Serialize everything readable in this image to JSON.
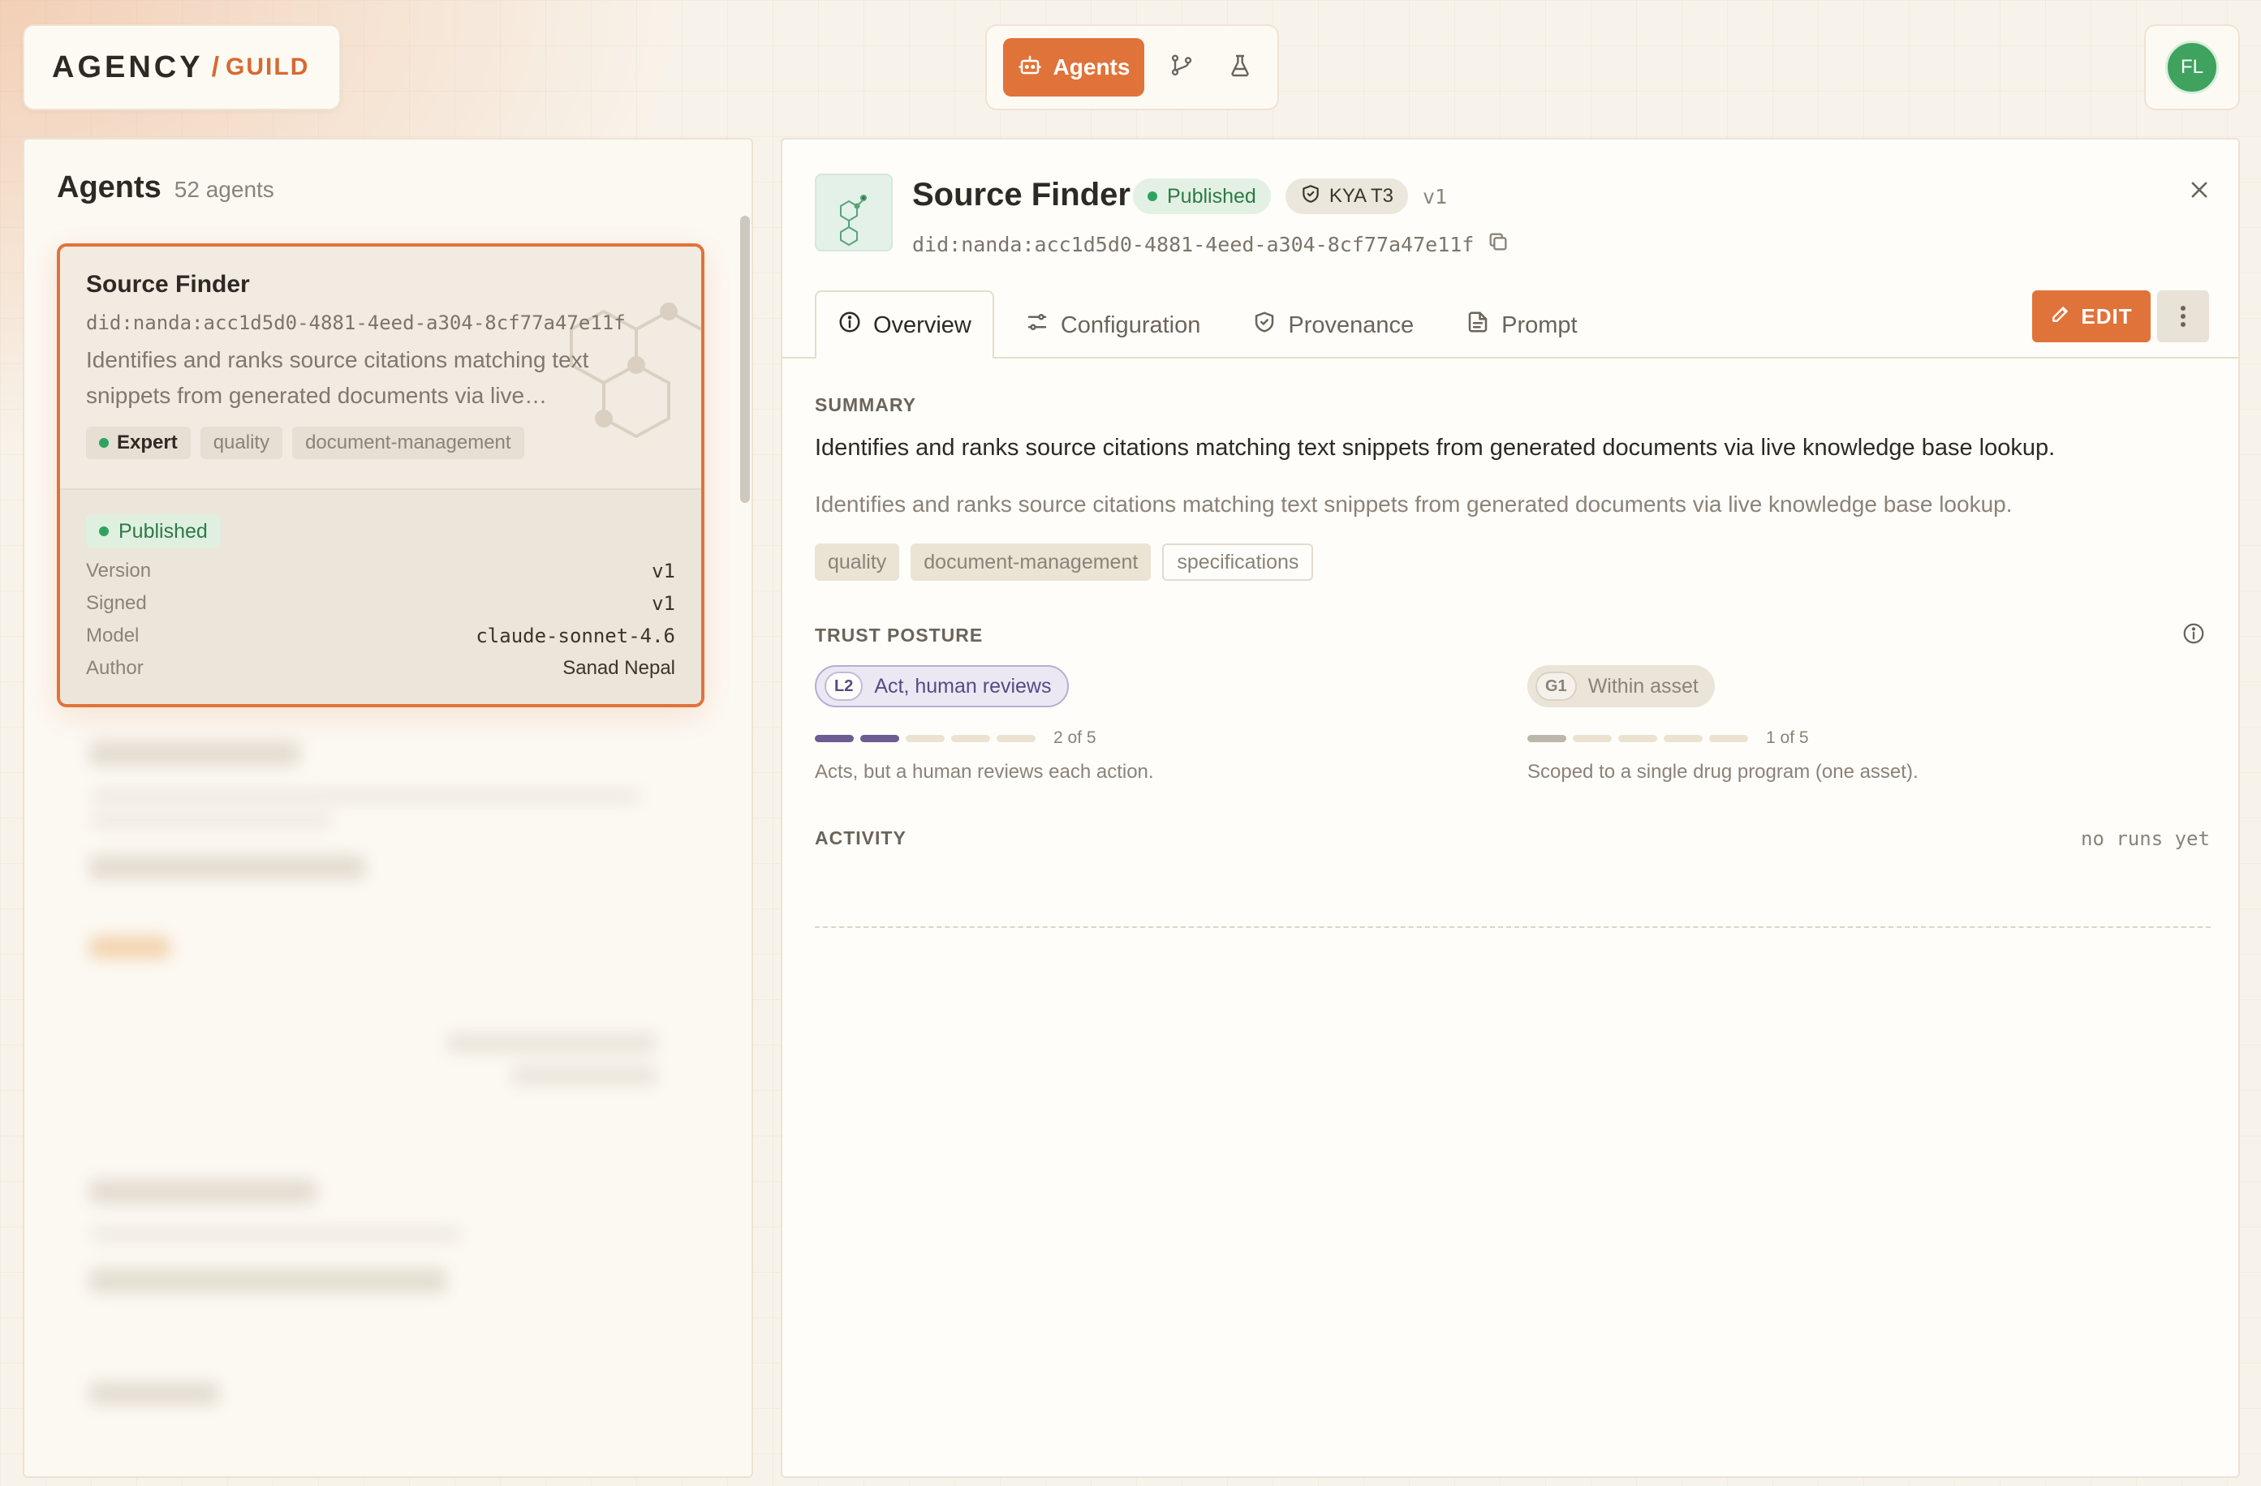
{
  "brand": {
    "name": "AGENCY",
    "sub": "GUILD",
    "accent": "#e0733a"
  },
  "nav": {
    "agents_label": "Agents",
    "icons": [
      "robot-icon",
      "git-branch-icon",
      "flask-icon"
    ]
  },
  "user": {
    "initials": "FL"
  },
  "list": {
    "title": "Agents",
    "count": "52 agents",
    "selected": {
      "name": "Source Finder",
      "did": "did:nanda:acc1d5d0-4881-4eed-a304-8cf77a47e11f",
      "description": "Identifies and ranks source citations matching text snippets from generated documents via live…",
      "tags": [
        "Expert",
        "quality",
        "document-management"
      ],
      "status": "Published",
      "fields": [
        {
          "key": "Version",
          "value": "v1"
        },
        {
          "key": "Signed",
          "value": "v1"
        },
        {
          "key": "Model",
          "value": "claude-sonnet-4.6"
        },
        {
          "key": "Author",
          "value": "Sanad Nepal"
        }
      ]
    }
  },
  "detail": {
    "title": "Source Finder",
    "status": "Published",
    "kya": "KYA T3",
    "version": "v1",
    "did": "did:nanda:acc1d5d0-4881-4eed-a304-8cf77a47e11f",
    "tabs": [
      "Overview",
      "Configuration",
      "Provenance",
      "Prompt"
    ],
    "edit_label": "EDIT",
    "summary_label": "SUMMARY",
    "summary": "Identifies and ranks source citations matching text snippets from generated documents via live knowledge base lookup.",
    "description": "Identifies and ranks source citations matching text snippets from generated documents via live knowledge base lookup.",
    "tags": [
      "quality",
      "document-management",
      "specifications"
    ],
    "trust_label": "TRUST POSTURE",
    "trust": [
      {
        "level": "L2",
        "label": "Act, human reviews",
        "value": 2,
        "max": 5,
        "count_text": "2 of 5",
        "desc": "Acts, but a human reviews each action.",
        "color": "#6b5c93"
      },
      {
        "level": "G1",
        "label": "Within asset",
        "value": 1,
        "max": 5,
        "count_text": "1 of 5",
        "desc": "Scoped to a single drug program (one asset).",
        "color": "#bdb6ab"
      }
    ],
    "activity_label": "ACTIVITY",
    "activity_empty": "no runs yet"
  }
}
